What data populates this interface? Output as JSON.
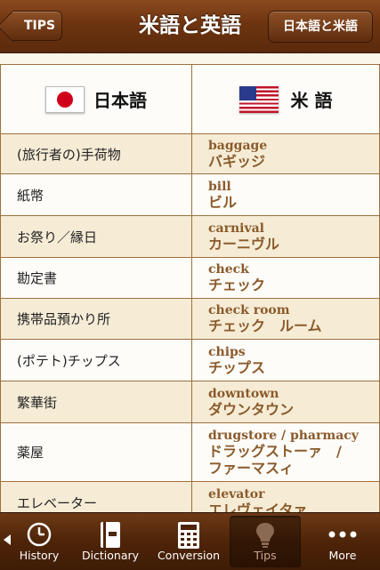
{
  "nav": {
    "title": "米語と英語",
    "back_label": "TIPS",
    "right_label": "日本語と米語"
  },
  "table": {
    "header": {
      "jp": "日本語",
      "us": "米 語"
    },
    "rows": [
      {
        "jp": "(旅行者の)手荷物",
        "en": "baggage",
        "kana": "バギッジ",
        "kana2": ""
      },
      {
        "jp": "紙幣",
        "en": "bill",
        "kana": "ビル",
        "kana2": ""
      },
      {
        "jp": "お祭り／縁日",
        "en": "carnival",
        "kana": "カーニヴル",
        "kana2": ""
      },
      {
        "jp": "勘定書",
        "en": "check",
        "kana": "チェック",
        "kana2": ""
      },
      {
        "jp": "携帯品預かり所",
        "en": "check room",
        "kana": "チェック　ルーム",
        "kana2": ""
      },
      {
        "jp": "(ポテト)チップス",
        "en": "chips",
        "kana": "チップス",
        "kana2": ""
      },
      {
        "jp": "繁華街",
        "en": "downtown",
        "kana": "ダウンタウン",
        "kana2": ""
      },
      {
        "jp": "薬屋",
        "en": "drugstore / pharmacy",
        "kana": "ドラッグストーァ　/",
        "kana2": "ファーマスィ"
      },
      {
        "jp": "エレベーター",
        "en": "elevator",
        "kana": "エレヴェイタァ",
        "kana2": ""
      }
    ]
  },
  "tabbar": {
    "tabs": [
      {
        "label": "History",
        "icon": "clock-icon"
      },
      {
        "label": "Dictionary",
        "icon": "book-icon"
      },
      {
        "label": "Conversion",
        "icon": "calculator-icon"
      },
      {
        "label": "Tips",
        "icon": "lightbulb-icon",
        "selected": true
      },
      {
        "label": "More",
        "icon": "more-dots-icon"
      }
    ]
  },
  "colors": {
    "nav_brown": "#6e3410",
    "term_brown": "#8b5a2b",
    "row_alt": "#f6ecd6",
    "border": "#a0703c",
    "flag_red": "#d0001c"
  }
}
